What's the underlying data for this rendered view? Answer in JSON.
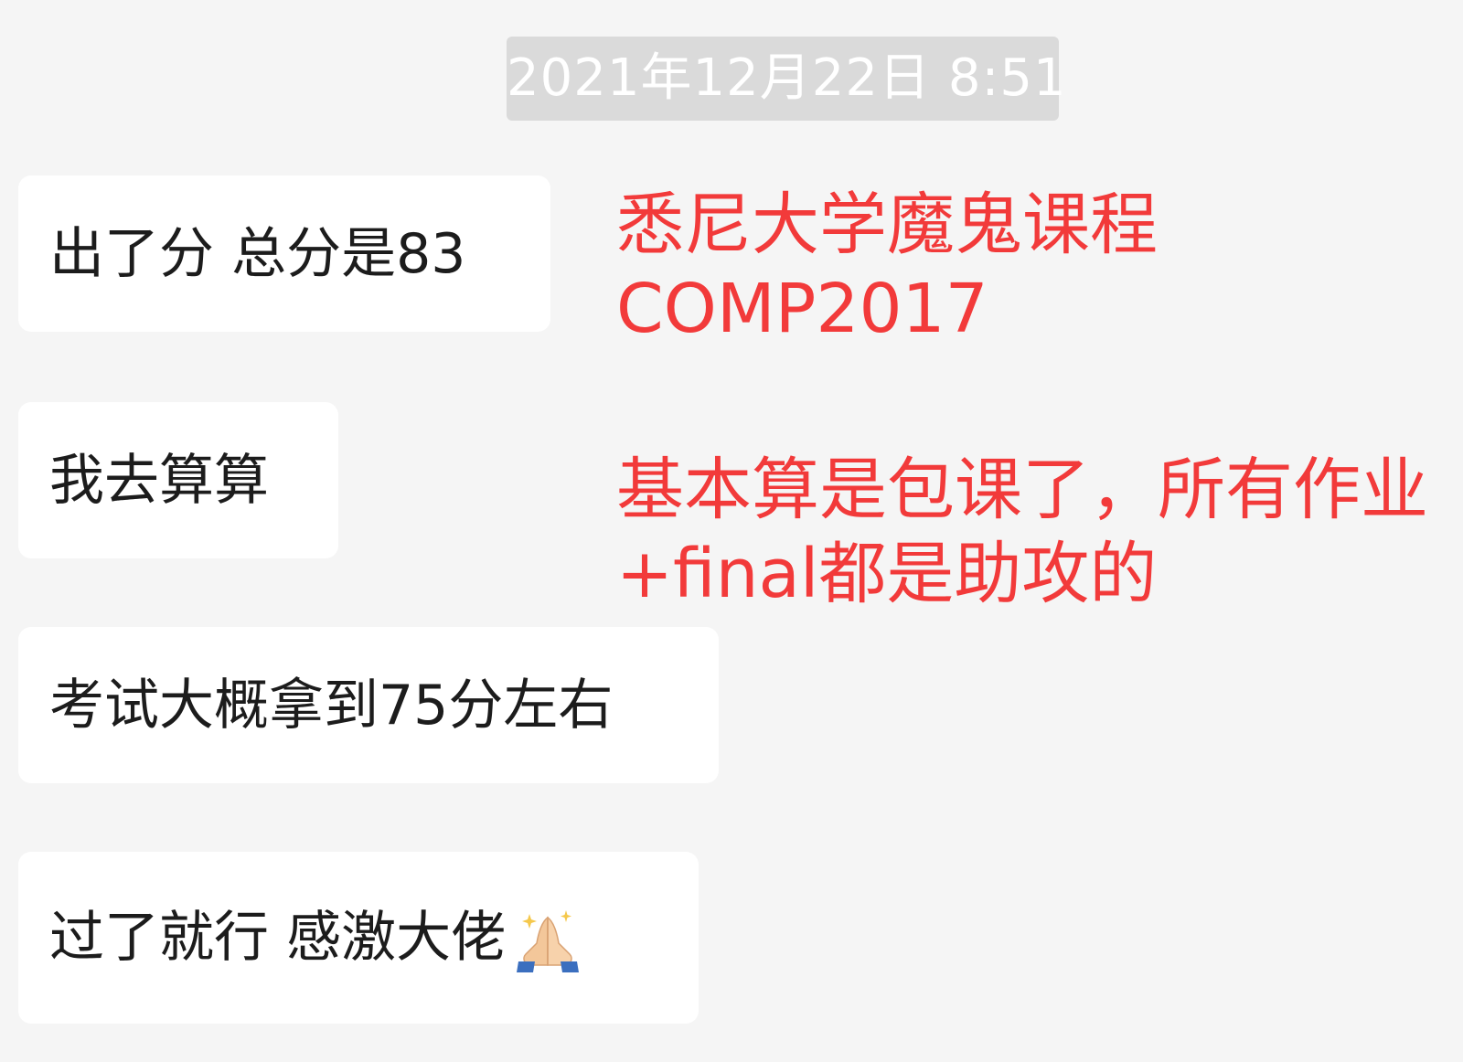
{
  "timestamp": "2021年12月22日 8:51",
  "messages": [
    {
      "text": "出了分 总分是83"
    },
    {
      "text": "我去算算"
    },
    {
      "text": "考试大概拿到75分左右"
    },
    {
      "text": "过了就行 感激大佬",
      "emoji": "folded-hands-icon"
    }
  ],
  "annotations": {
    "course_title": "悉尼大学魔鬼课程",
    "course_code": "COMP2017",
    "note_line1": "基本算是包课了，所有作业",
    "note_line2": "+final都是助攻的"
  },
  "colors": {
    "background": "#f5f5f5",
    "timestamp_bg": "#dadada",
    "bubble_bg": "#ffffff",
    "annotation_red": "#f23a3a"
  }
}
